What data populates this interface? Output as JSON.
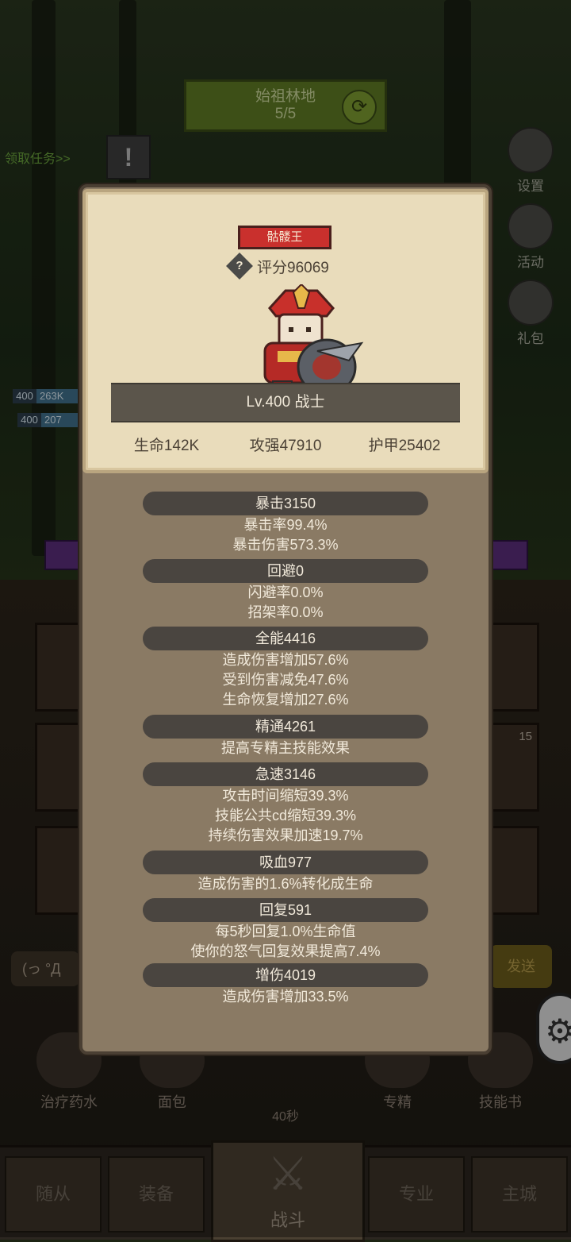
{
  "top": {
    "zone_name": "始祖林地",
    "zone_progress": "5/5",
    "quest_link": "领取任务>>",
    "quest_alert": "!"
  },
  "side_menu": [
    {
      "label": "设置",
      "icon": "gear-icon"
    },
    {
      "label": "活动",
      "icon": "scroll-icon"
    },
    {
      "label": "礼包",
      "icon": "gift-icon"
    }
  ],
  "party_bars": [
    {
      "level": "400",
      "hp": "263K"
    },
    {
      "level": "400",
      "hp": "207"
    }
  ],
  "character": {
    "title_badge": "骷髅王",
    "rating": "评分96069",
    "level_class": "Lv.400 战士",
    "hp": "生命142K",
    "attack": "攻强47910",
    "armor": "护甲25402"
  },
  "stats": [
    {
      "head": "暴击3150",
      "lines": [
        "暴击率99.4%",
        "暴击伤害573.3%"
      ]
    },
    {
      "head": "回避0",
      "lines": [
        "闪避率0.0%",
        "招架率0.0%"
      ]
    },
    {
      "head": "全能4416",
      "lines": [
        "造成伤害增加57.6%",
        "受到伤害减免47.6%",
        "生命恢复增加27.6%"
      ]
    },
    {
      "head": "精通4261",
      "lines": [
        "提高专精主技能效果"
      ]
    },
    {
      "head": "急速3146",
      "lines": [
        "攻击时间缩短39.3%",
        "技能公共cd缩短39.3%",
        "持续伤害效果加速19.7%"
      ]
    },
    {
      "head": "吸血977",
      "lines": [
        "造成伤害的1.6%转化成生命"
      ]
    },
    {
      "head": "回复591",
      "lines": [
        "每5秒回复1.0%生命值",
        "使你的怒气回复效果提高7.4%"
      ]
    },
    {
      "head": "增伤4019",
      "lines": [
        "造成伤害增加33.5%"
      ]
    }
  ],
  "chat": {
    "emote": "(っ °Д",
    "send": "发送"
  },
  "slot_badge": "15",
  "actions": [
    {
      "label": "治疗药水"
    },
    {
      "label": "面包"
    },
    {
      "label": "专精"
    },
    {
      "label": "技能书"
    }
  ],
  "chest_timer": "40秒",
  "nav": {
    "followers": "随从",
    "equipment": "装备",
    "battle": "战斗",
    "profession": "专业",
    "main_city": "主城"
  }
}
